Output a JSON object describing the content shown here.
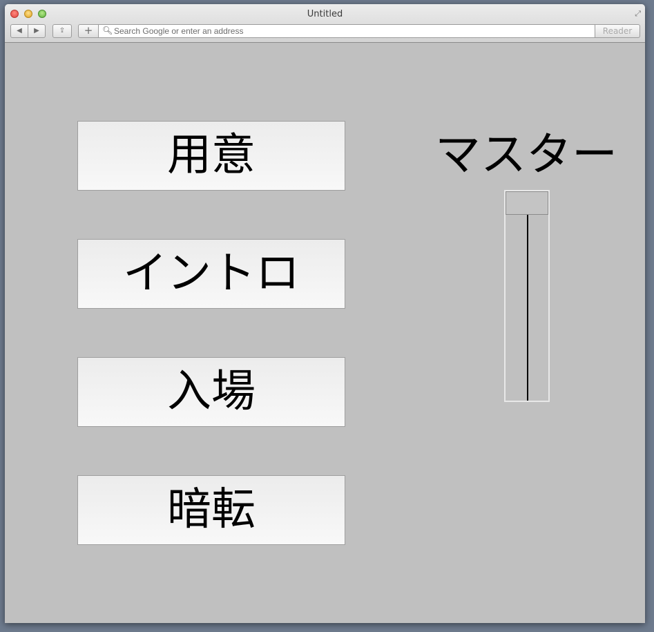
{
  "window": {
    "title": "Untitled"
  },
  "toolbar": {
    "back_label": "◀",
    "forward_label": "▶",
    "share_label": "⇪",
    "add_label": "+",
    "address_placeholder": "Search Google or enter an address",
    "address_value": "",
    "reader_label": "Reader",
    "icons": [
      "back-icon",
      "forward-icon",
      "share-icon",
      "plus-icon",
      "search-icon",
      "fullscreen-icon"
    ]
  },
  "cues": [
    {
      "label": "用意"
    },
    {
      "label": "イントロ"
    },
    {
      "label": "入場"
    },
    {
      "label": "暗転"
    }
  ],
  "master": {
    "label": "マスター",
    "level": 1.0
  },
  "colors": {
    "background": "#c0c0c0",
    "button_top": "#ececec",
    "button_bottom": "#f8f8f8",
    "text": "#000000"
  }
}
